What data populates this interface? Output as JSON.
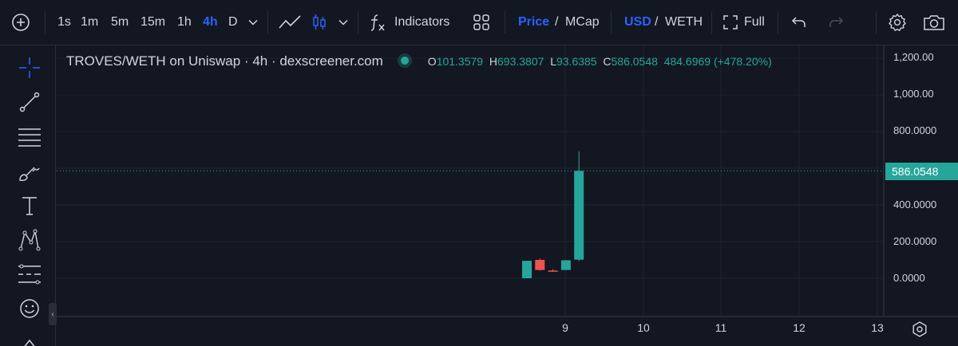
{
  "toolbar": {
    "intervals": [
      "1s",
      "1m",
      "5m",
      "15m",
      "1h",
      "4h",
      "D"
    ],
    "active_interval": "4h",
    "indicators_label": "Indicators",
    "price_label": "Price",
    "divider": "/",
    "mcap_label": "MCap",
    "usd_label": "USD",
    "weth_label": "WETH",
    "full_label": "Full"
  },
  "legend": {
    "symbol": "TROVES/WETH on Uniswap · 4h · dexscreener.com",
    "o_label": "O",
    "o_value": "101.3579",
    "h_label": "H",
    "h_value": "693.3807",
    "l_label": "L",
    "l_value": "93.6385",
    "c_label": "C",
    "c_value": "586.0548",
    "change": "484.6969 (+478.20%)"
  },
  "price_axis": {
    "ticks": [
      "1,200.00",
      "1,000.00",
      "800.0000",
      "400.0000",
      "200.0000",
      "0.0000"
    ],
    "last_price": "586.0548"
  },
  "time_axis": {
    "ticks": [
      "9",
      "10",
      "11",
      "12",
      "13"
    ]
  },
  "colors": {
    "up": "#26a69a",
    "down": "#ef5350",
    "accent": "#2962ff",
    "background": "#131722"
  },
  "chart_data": {
    "type": "candlestick",
    "pair": "TROVES/WETH",
    "interval": "4h",
    "ylim": [
      -80,
      1240
    ],
    "yticks": [
      1200,
      1000,
      800,
      600,
      400,
      200,
      0
    ],
    "xticks": [
      "9",
      "10",
      "11",
      "12",
      "13"
    ],
    "candles": [
      {
        "o": 0,
        "h": 95,
        "l": 0,
        "c": 95
      },
      {
        "o": 100,
        "h": 108,
        "l": 42,
        "c": 45
      },
      {
        "o": 42,
        "h": 50,
        "l": 35,
        "c": 40
      },
      {
        "o": 45,
        "h": 100,
        "l": 45,
        "c": 98
      },
      {
        "o": 101.3579,
        "h": 693.3807,
        "l": 93.6385,
        "c": 586.0548
      }
    ]
  }
}
